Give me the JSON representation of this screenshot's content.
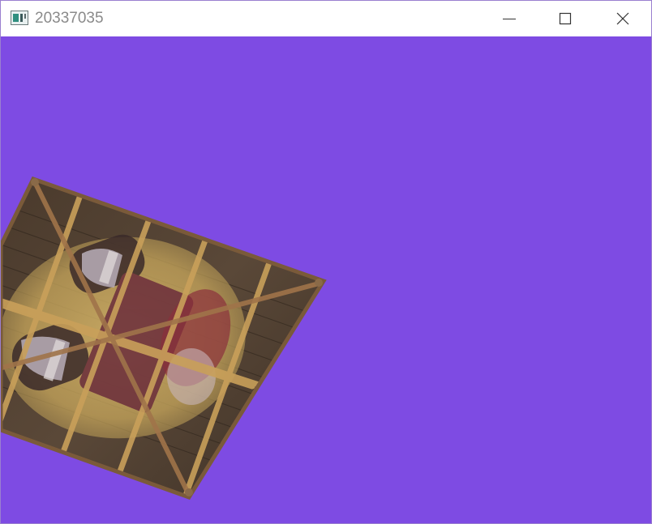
{
  "window": {
    "title": "20337035",
    "controls": {
      "minimize_icon": "minimize-icon",
      "maximize_icon": "maximize-icon",
      "close_icon": "close-icon"
    }
  },
  "viewport": {
    "clear_color": "#7e4be3",
    "object": "textured-wooden-crate-quad"
  }
}
